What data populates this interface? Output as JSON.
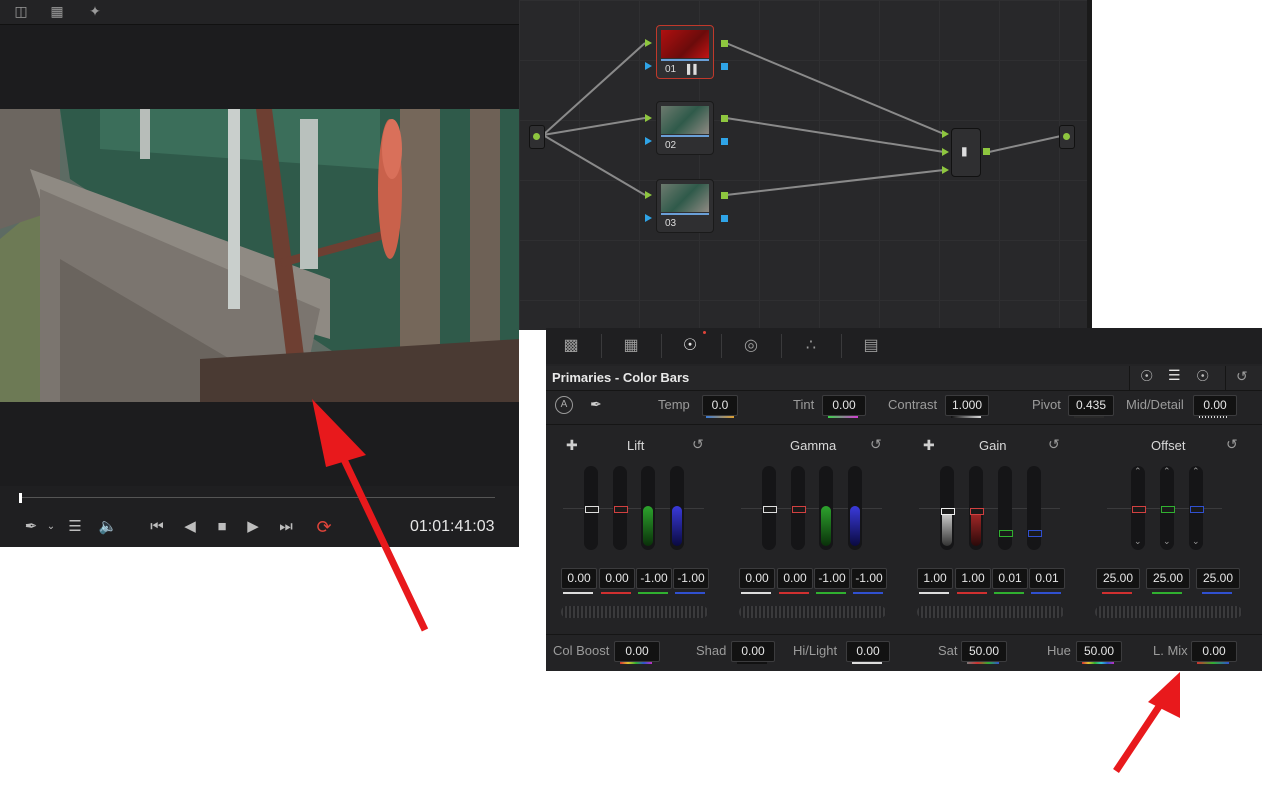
{
  "viewer": {
    "timecode": "01:01:41:03",
    "icons": [
      "viewer-layout-icon",
      "grid-icon",
      "magic-wand-icon"
    ],
    "transport": [
      "pen-icon",
      "layers-icon",
      "speaker-icon",
      "skip-back-icon",
      "step-back-icon",
      "stop-icon",
      "play-icon",
      "skip-forward-icon",
      "loop-icon"
    ]
  },
  "nodes": {
    "items": [
      {
        "label": "01"
      },
      {
        "label": "02"
      },
      {
        "label": "03"
      }
    ]
  },
  "panel": {
    "title": "Primaries - Color Bars",
    "top_params": [
      {
        "label": "Temp",
        "value": "0.0"
      },
      {
        "label": "Tint",
        "value": "0.00"
      },
      {
        "label": "Contrast",
        "value": "1.000"
      },
      {
        "label": "Pivot",
        "value": "0.435"
      },
      {
        "label": "Mid/Detail",
        "value": "0.00"
      }
    ],
    "wheels": [
      {
        "name": "Lift",
        "values": [
          "0.00",
          "0.00",
          "-1.00",
          "-1.00"
        ]
      },
      {
        "name": "Gamma",
        "values": [
          "0.00",
          "0.00",
          "-1.00",
          "-1.00"
        ]
      },
      {
        "name": "Gain",
        "values": [
          "1.00",
          "1.00",
          "0.01",
          "0.01"
        ]
      },
      {
        "name": "Offset",
        "values": [
          "25.00",
          "25.00",
          "25.00"
        ]
      }
    ],
    "bottom_params": [
      {
        "label": "Col Boost",
        "value": "0.00"
      },
      {
        "label": "Shad",
        "value": "0.00"
      },
      {
        "label": "Hi/Light",
        "value": "0.00"
      },
      {
        "label": "Sat",
        "value": "50.00"
      },
      {
        "label": "Hue",
        "value": "50.00"
      },
      {
        "label": "L. Mix",
        "value": "0.00"
      }
    ]
  },
  "colors": {
    "accent_arrow": "#e8191c",
    "node_port_green": "#8ec63f",
    "node_port_blue": "#2fa4e7",
    "loop_red": "#e0443a"
  }
}
